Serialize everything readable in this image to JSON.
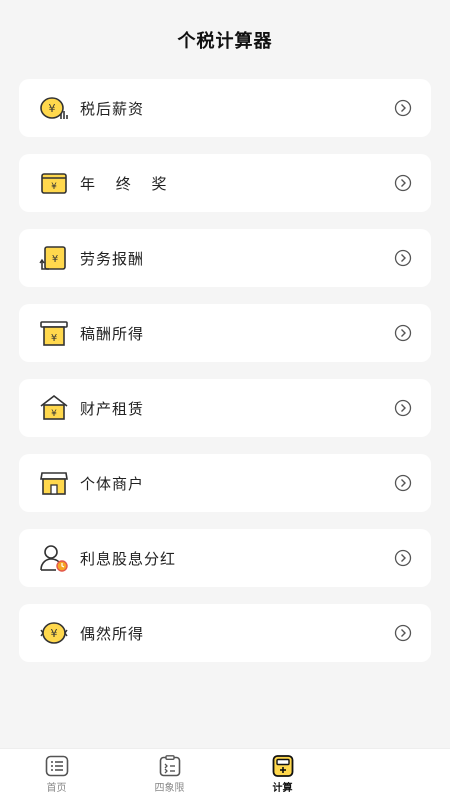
{
  "header": {
    "title": "个税计算器"
  },
  "items": [
    {
      "label": "税后薪资",
      "icon": "salary-coin-icon"
    },
    {
      "label": "年 终 奖",
      "icon": "year-end-bonus-wallet-icon"
    },
    {
      "label": "劳务报酬",
      "icon": "labor-remuneration-exchange-icon"
    },
    {
      "label": "稿酬所得",
      "icon": "manuscript-fee-icon"
    },
    {
      "label": "财产租赁",
      "icon": "property-rental-house-icon"
    },
    {
      "label": "个体商户",
      "icon": "individual-business-store-icon"
    },
    {
      "label": "利息股息分红",
      "icon": "interest-dividend-user-icon"
    },
    {
      "label": "偶然所得",
      "icon": "incidental-income-coin-icon"
    }
  ],
  "tabbar": {
    "tabs": [
      {
        "label": "首页",
        "icon": "home-list-icon",
        "active": false
      },
      {
        "label": "四象限",
        "icon": "quadrant-clipboard-icon",
        "active": false
      },
      {
        "label": "计算",
        "icon": "calculator-icon",
        "active": true
      }
    ]
  },
  "colors": {
    "accent": "#FFD84D",
    "icon_stroke": "#333333",
    "background": "#F5F5F5"
  }
}
